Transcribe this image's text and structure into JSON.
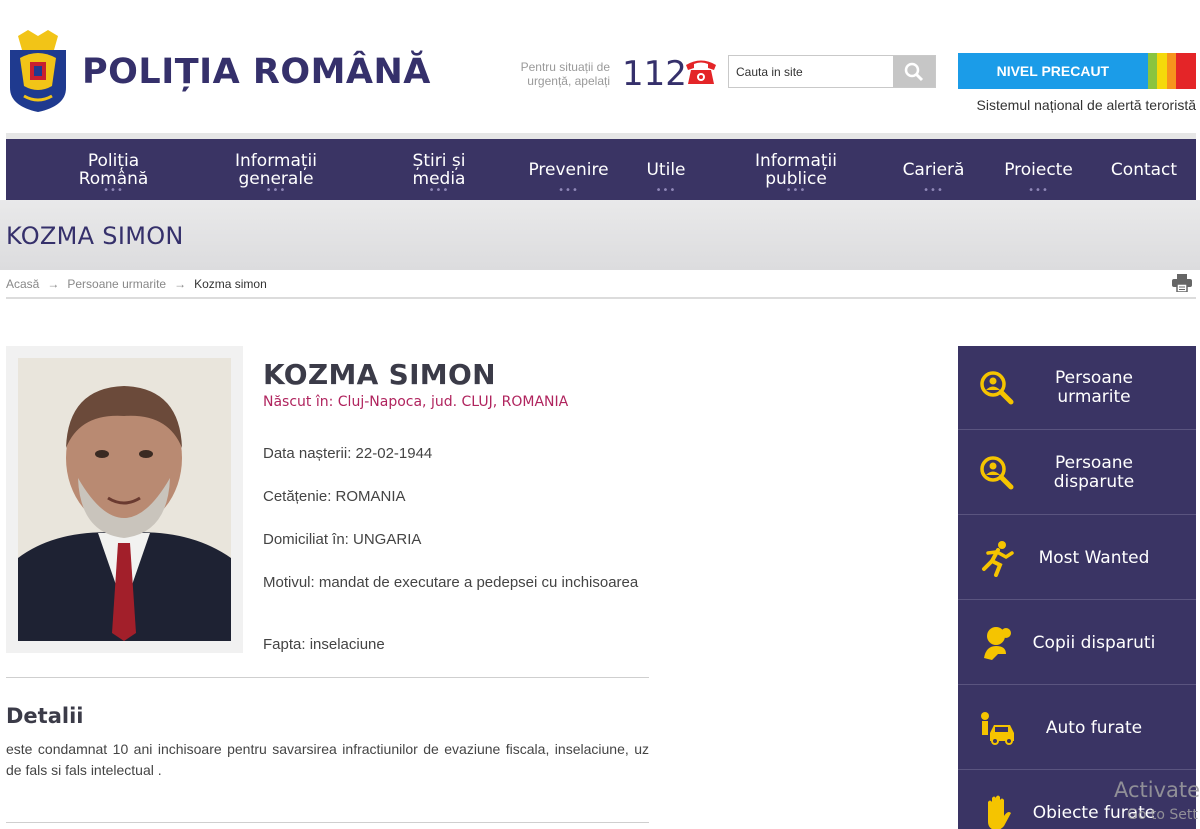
{
  "header": {
    "brand": "POLIȚIA ROMÂNĂ",
    "emergency_line1": "Pentru situații de",
    "emergency_line2": "urgență, apelați",
    "emergency_number": "112",
    "search_placeholder": "Cauta in site",
    "alert_level": "NIVEL PRECAUT",
    "alert_caption": "Sistemul național de alertă teroristă",
    "alert_colors": [
      "#1b9ce8",
      "#8ac43f",
      "#f5d90a",
      "#f7941d",
      "#e42528"
    ]
  },
  "nav": [
    {
      "line1": "Poliția",
      "line2": "Română"
    },
    {
      "line1": "Informații",
      "line2": "generale"
    },
    {
      "line1": "Știri și",
      "line2": "media"
    },
    {
      "line1": "Prevenire",
      "line2": ""
    },
    {
      "line1": "Utile",
      "line2": ""
    },
    {
      "line1": "Informații",
      "line2": "publice"
    },
    {
      "line1": "Carieră",
      "line2": ""
    },
    {
      "line1": "Proiecte",
      "line2": ""
    },
    {
      "line1": "Contact",
      "line2": ""
    }
  ],
  "page_title": "KOZMA SIMON",
  "breadcrumb": {
    "home": "Acasă",
    "section": "Persoane urmarite",
    "current": "Kozma simon",
    "separator": "→"
  },
  "person": {
    "name": "KOZMA SIMON",
    "born": "Născut în: Cluj-Napoca, jud. CLUJ, ROMANIA",
    "birth_date": "Data nașterii: 22-02-1944",
    "citizenship": "Cetățenie: ROMANIA",
    "domicile": "Domiciliat în: UNGARIA",
    "reason": "Motivul: mandat de executare a pedepsei cu inchisoarea",
    "deed": "Fapta: inselaciune"
  },
  "details": {
    "heading": "Detalii",
    "text": "este condamnat 10 ani inchisoare pentru savarsirea infractiunilor de evaziune fiscala, inselaciune, uz de fals si fals intelectual ."
  },
  "sidebar": [
    {
      "label": "Persoane urmarite",
      "icon": "search-person-icon"
    },
    {
      "label": "Persoane disparute",
      "icon": "search-person-icon"
    },
    {
      "label": "Most Wanted",
      "icon": "running-man-icon"
    },
    {
      "label": "Copii disparuti",
      "icon": "child-icon"
    },
    {
      "label": "Auto furate",
      "icon": "car-thief-icon"
    },
    {
      "label": "Obiecte furate",
      "icon": "hand-icon"
    }
  ],
  "accent_colors": {
    "navy": "#3a3464",
    "icon_yellow": "#f5c400",
    "born_red": "#b0245e"
  },
  "watermark": {
    "line1": "Activate",
    "line2": "Go to Sett"
  }
}
